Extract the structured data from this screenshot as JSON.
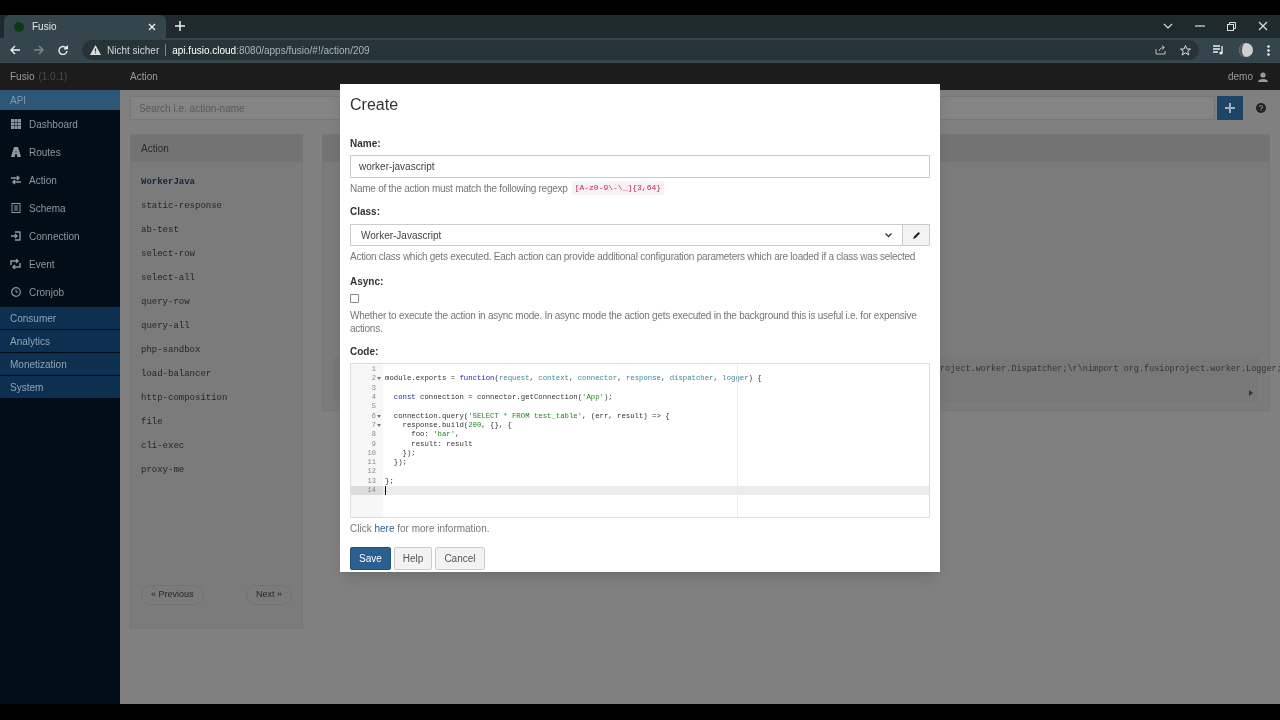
{
  "browser": {
    "tab": {
      "title": "Fusio"
    },
    "security_label": "Nicht sicher",
    "url_host": "api.fusio.cloud",
    "url_path": ":8080/apps/fusio/#!/action/209"
  },
  "navbar": {
    "brand": "Fusio",
    "version": "(1.0.1)",
    "page_title": "Action",
    "user": "demo"
  },
  "sidebar": {
    "section": "API",
    "items": [
      "Dashboard",
      "Routes",
      "Action",
      "Schema",
      "Connection",
      "Event",
      "Cronjob"
    ],
    "groups": [
      "Consumer",
      "Analytics",
      "Monetization",
      "System"
    ]
  },
  "search": {
    "placeholder": "Search i.e. action-name"
  },
  "action_list": {
    "heading": "Action",
    "items": [
      {
        "label": "WorkerJava",
        "selected": true
      },
      {
        "label": "static-response",
        "selected": false
      },
      {
        "label": "ab-test",
        "selected": false
      },
      {
        "label": "select-row",
        "selected": false
      },
      {
        "label": "select-all",
        "selected": false
      },
      {
        "label": "query-row",
        "selected": false
      },
      {
        "label": "query-all",
        "selected": false
      },
      {
        "label": "php-sandbox",
        "selected": false
      },
      {
        "label": "load-balancer",
        "selected": false
      },
      {
        "label": "http-composition",
        "selected": false
      },
      {
        "label": "file",
        "selected": false
      },
      {
        "label": "cli-exec",
        "selected": false
      },
      {
        "label": "proxy-me",
        "selected": false
      }
    ],
    "previous": "« Previous",
    "next": "Next »"
  },
  "detail_panel": {
    "code_fragment": "roject.worker.Dispatcher;\\r\\nimport org.fusioproject.worker.Logger;"
  },
  "modal": {
    "title": "Create",
    "name": {
      "label": "Name:",
      "value": "worker-javascript",
      "help": "Name of the action must match the following regexp",
      "pattern": "[A-z0-9\\-\\_]{3,64}"
    },
    "class": {
      "label": "Class:",
      "value": "Worker-Javascript",
      "help": "Action class which gets executed. Each action can provide additional configuration parameters which are loaded if a class was selected"
    },
    "async": {
      "label": "Async:",
      "checked": false,
      "help": "Whether to execute the action in async mode. In async mode the action gets executed in the background this is useful i.e. for expensive actions."
    },
    "code": {
      "label": "Code:",
      "lines": [
        {
          "number": "1",
          "fold": false,
          "active": false
        },
        {
          "number": "2",
          "fold": true,
          "active": false,
          "tokens": [
            {
              "kind": "plain",
              "text": "module.exports = "
            },
            {
              "kind": "keyword",
              "text": "function"
            },
            {
              "kind": "plain",
              "text": "("
            },
            {
              "kind": "param",
              "text": "request"
            },
            {
              "kind": "plain",
              "text": ", "
            },
            {
              "kind": "param",
              "text": "context"
            },
            {
              "kind": "plain",
              "text": ", "
            },
            {
              "kind": "param",
              "text": "connector"
            },
            {
              "kind": "plain",
              "text": ", "
            },
            {
              "kind": "param",
              "text": "response"
            },
            {
              "kind": "plain",
              "text": ", "
            },
            {
              "kind": "param",
              "text": "dispatcher"
            },
            {
              "kind": "plain",
              "text": ", "
            },
            {
              "kind": "param",
              "text": "logger"
            },
            {
              "kind": "plain",
              "text": ") {"
            }
          ]
        },
        {
          "number": "3",
          "fold": false,
          "active": false
        },
        {
          "number": "4",
          "fold": false,
          "active": false,
          "tokens": [
            {
              "kind": "keyword",
              "text": "  const"
            },
            {
              "kind": "plain",
              "text": " connection = connector.getConnection("
            },
            {
              "kind": "string",
              "text": "'App'"
            },
            {
              "kind": "plain",
              "text": ");"
            }
          ]
        },
        {
          "number": "5",
          "fold": false,
          "active": false
        },
        {
          "number": "6",
          "fold": true,
          "active": false,
          "tokens": [
            {
              "kind": "plain",
              "text": "  connection.query("
            },
            {
              "kind": "string",
              "text": "'SELECT * FROM test_table'"
            },
            {
              "kind": "plain",
              "text": ", (err, result) => {"
            }
          ]
        },
        {
          "number": "7",
          "fold": true,
          "active": false,
          "tokens": [
            {
              "kind": "plain",
              "text": "    response.build("
            },
            {
              "kind": "number",
              "text": "200"
            },
            {
              "kind": "plain",
              "text": ", {}, {"
            }
          ]
        },
        {
          "number": "8",
          "fold": false,
          "active": false,
          "tokens": [
            {
              "kind": "plain",
              "text": "      foo: "
            },
            {
              "kind": "string",
              "text": "'bar'"
            },
            {
              "kind": "plain",
              "text": ","
            }
          ]
        },
        {
          "number": "9",
          "fold": false,
          "active": false,
          "tokens": [
            {
              "kind": "plain",
              "text": "      result: result"
            }
          ]
        },
        {
          "number": "10",
          "fold": false,
          "active": false,
          "tokens": [
            {
              "kind": "plain",
              "text": "    });"
            }
          ]
        },
        {
          "number": "11",
          "fold": false,
          "active": false,
          "tokens": [
            {
              "kind": "plain",
              "text": "  });"
            }
          ]
        },
        {
          "number": "12",
          "fold": false,
          "active": false
        },
        {
          "number": "13",
          "fold": false,
          "active": false,
          "tokens": [
            {
              "kind": "plain",
              "text": "};"
            }
          ]
        },
        {
          "number": "14",
          "fold": false,
          "active": true
        }
      ]
    },
    "info": {
      "before": "Click",
      "link": "here",
      "after": "for more information."
    },
    "buttons": [
      {
        "label": "Save",
        "kind": "primary"
      },
      {
        "label": "Help",
        "kind": "default"
      },
      {
        "label": "Cancel",
        "kind": "default"
      }
    ]
  }
}
